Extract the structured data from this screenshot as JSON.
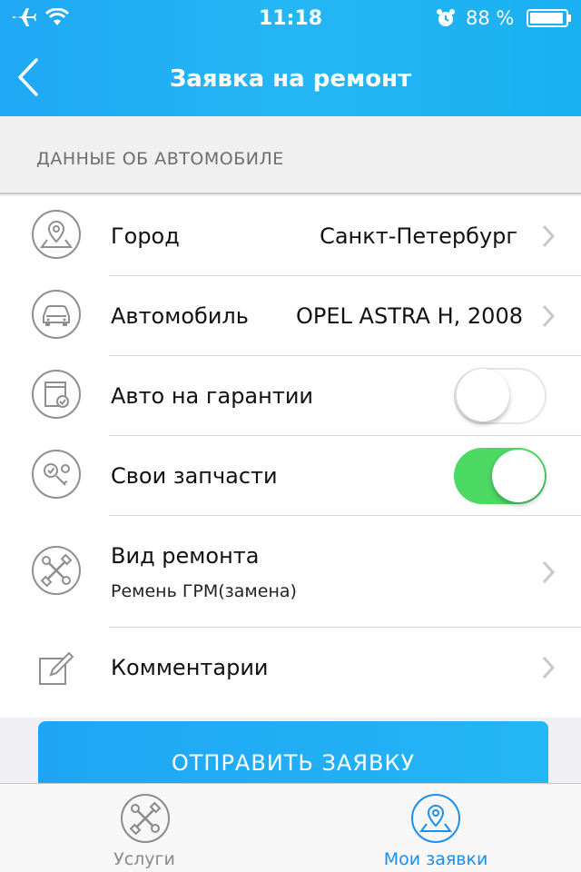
{
  "status_bar": {
    "time": "11:18",
    "battery_percent": "88 %"
  },
  "nav": {
    "title": "Заявка на ремонт"
  },
  "section": {
    "header": "ДАННЫЕ ОБ АВТОМОБИЛЕ"
  },
  "rows": {
    "city": {
      "label": "Город",
      "value": "Санкт-Петербург",
      "icon": "map-pin-icon"
    },
    "car": {
      "label": "Автомобиль",
      "value": "OPEL ASTRA H, 2008",
      "icon": "car-icon"
    },
    "warranty": {
      "label": "Авто на гарантии",
      "toggle_on": false,
      "icon": "warranty-doc-icon"
    },
    "own_parts": {
      "label": "Свои запчасти",
      "toggle_on": true,
      "icon": "parts-check-icon"
    },
    "repair_type": {
      "label": "Вид ремонта",
      "value": "Ремень ГРМ(замена)",
      "icon": "tools-icon"
    },
    "comments": {
      "label": "Комментарии",
      "icon": "edit-icon"
    }
  },
  "submit": {
    "label": "ОТПРАВИТЬ ЗАЯВКУ"
  },
  "tabbar": {
    "services": {
      "label": "Услуги",
      "icon": "tools-icon",
      "active": false
    },
    "my_requests": {
      "label": "Мои заявки",
      "icon": "map-pin-icon",
      "active": true
    }
  },
  "colors": {
    "accent": "#1fa8f5",
    "toggle_on": "#4cd964",
    "tab_active": "#1a8ff0",
    "tab_inactive": "#8a8a8f"
  }
}
